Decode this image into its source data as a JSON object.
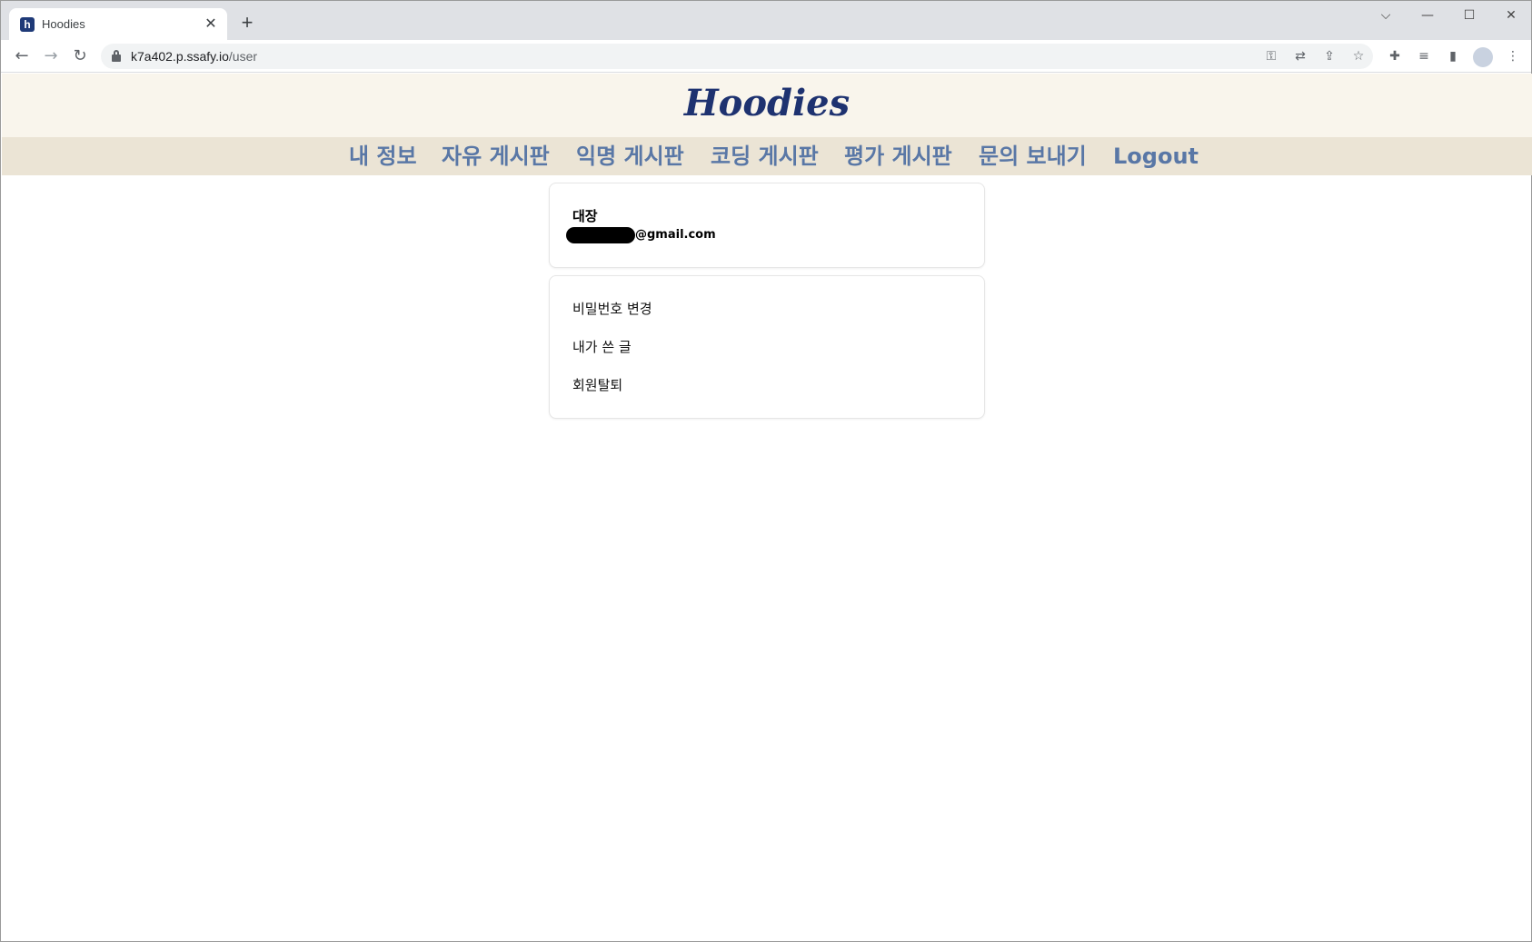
{
  "browser": {
    "tab_title": "Hoodies",
    "tab_favicon": "h",
    "tab_close": "✕",
    "new_tab": "+",
    "url_host": "k7a402.p.ssafy.io",
    "url_path": "/user",
    "controls": {
      "tabsearch": "⌵",
      "minimize": "—",
      "maximize": "☐",
      "close": "✕"
    }
  },
  "header": {
    "logo": "Hoodies"
  },
  "nav": {
    "items": [
      "내 정보",
      "자유 게시판",
      "익명 게시판",
      "코딩 게시판",
      "평가 게시판",
      "문의 보내기",
      "Logout"
    ]
  },
  "profile": {
    "nickname": "대장",
    "email_suffix": "@gmail.com"
  },
  "menu": {
    "items": [
      "비밀번호 변경",
      "내가 쓴 글",
      "회원탈퇴"
    ]
  }
}
